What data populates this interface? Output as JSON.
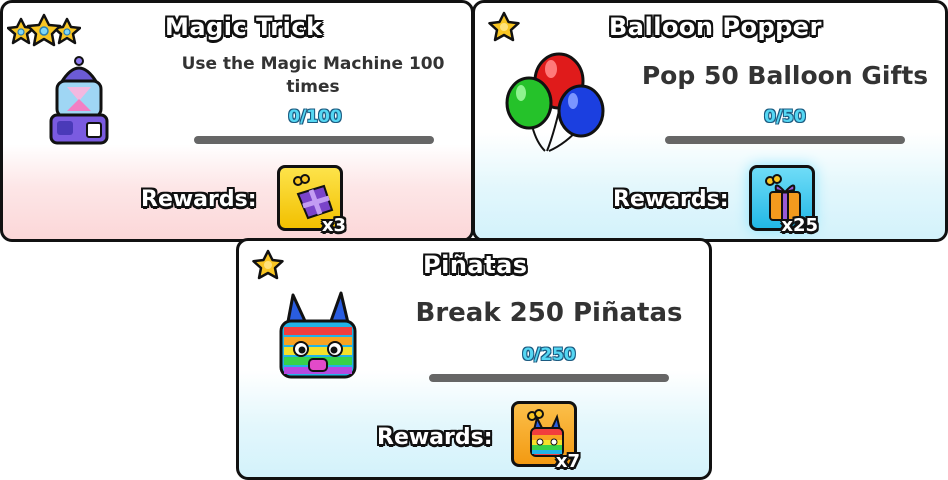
{
  "quests": [
    {
      "title": "Magic Trick",
      "description": "Use the Magic Machine 100 times",
      "progress_text": "0/100",
      "progress": 0,
      "rewards_label": "Rewards:",
      "reward_count": "x3",
      "tier_stars": 3,
      "reward_box_color": "#f5d31c"
    },
    {
      "title": "Balloon Popper",
      "description": "Pop 50 Balloon Gifts",
      "progress_text": "0/50",
      "progress": 0,
      "rewards_label": "Rewards:",
      "reward_count": "x25",
      "tier_stars": 1,
      "reward_box_color": "#3fc8ef"
    },
    {
      "title": "Piñatas",
      "description": "Break 250 Piñatas",
      "progress_text": "0/250",
      "progress": 0,
      "rewards_label": "Rewards:",
      "reward_count": "x7",
      "tier_stars": 1,
      "reward_box_color": "#f7a521"
    }
  ],
  "icons": {
    "quest_icons": [
      "magic-machine-icon",
      "balloons-icon",
      "pinata-icon"
    ],
    "reward_icons": [
      "magic-gift-icon",
      "balloon-gift-icon",
      "pinata-reward-icon"
    ],
    "tier_icon": "gold-star-icon"
  },
  "colors": {
    "progress_text": "#55d7f3",
    "bar_track": "#666666",
    "magic_card_tint": "#fbd7d8",
    "blue_card_tint": "#d3f2fb"
  }
}
